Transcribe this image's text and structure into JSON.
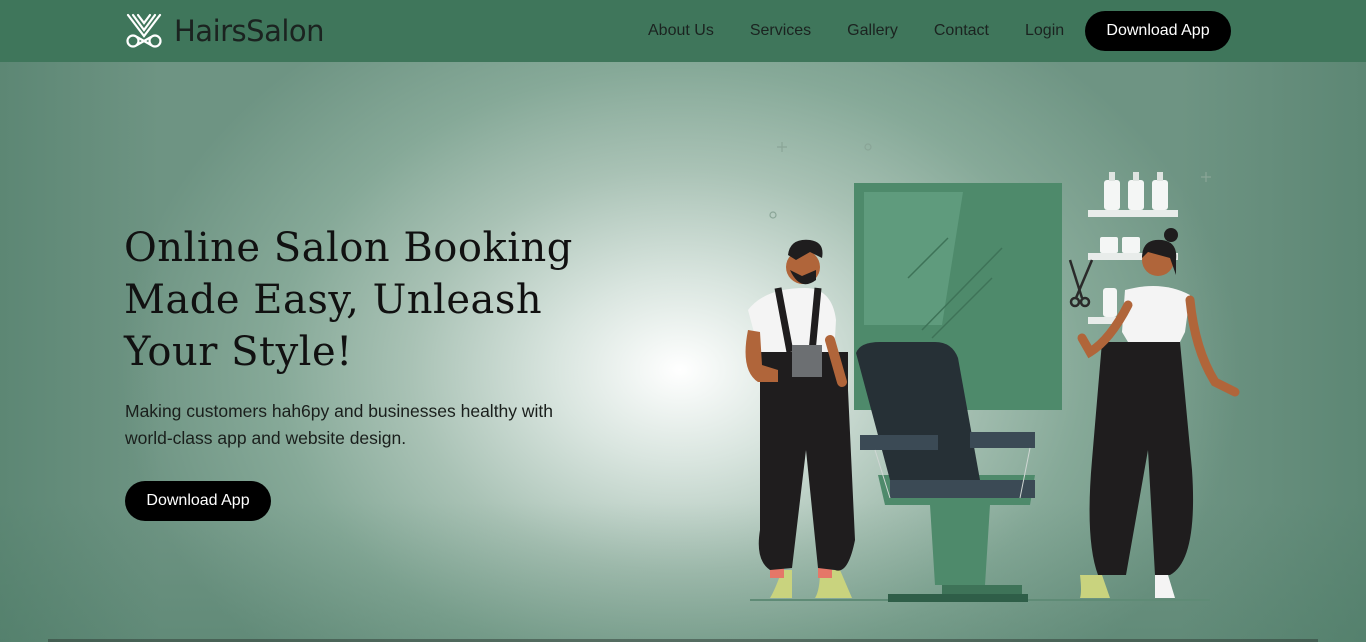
{
  "header": {
    "brand": "HairsSalon",
    "nav": [
      "About Us",
      "Services",
      "Gallery",
      "Contact",
      "Login"
    ],
    "cta": "Download App"
  },
  "hero": {
    "title": "Online Salon Booking Made Easy, Unleash Your Style!",
    "subtitle": "Making customers hah6py and businesses healthy with world-class app and website design.",
    "cta": "Download App"
  },
  "icons": {
    "logo": "scissors-logo-icon",
    "illustration": "salon-illustration"
  },
  "colors": {
    "header_bg": "#3f765b",
    "button_bg": "#000000",
    "button_text": "#ffffff",
    "accent_green": "#4e8a6b"
  }
}
